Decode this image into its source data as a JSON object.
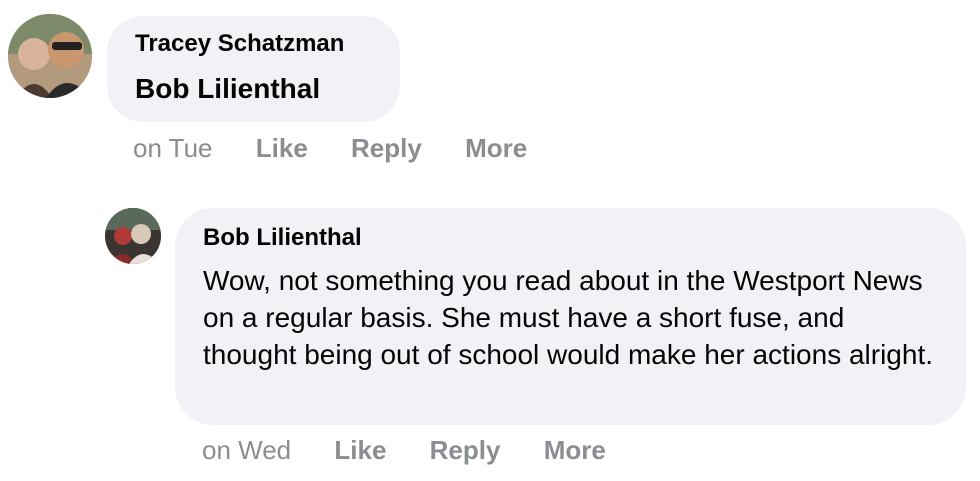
{
  "comments": [
    {
      "author": "Tracey Schatzman",
      "text": "Bob Lilienthal",
      "timestamp": "on Tue",
      "actions": {
        "like": "Like",
        "reply": "Reply",
        "more": "More"
      }
    },
    {
      "author": "Bob Lilienthal",
      "text": "Wow, not something you read about in the Westport News on a regular basis. She must have a short fuse, and thought being out of school would make her actions alright.",
      "timestamp": "on Wed",
      "actions": {
        "like": "Like",
        "reply": "Reply",
        "more": "More"
      }
    }
  ],
  "colors": {
    "bubble_bg": "#f0f2f5",
    "secondary_text": "#8a8d91",
    "primary_text": "#050505"
  }
}
